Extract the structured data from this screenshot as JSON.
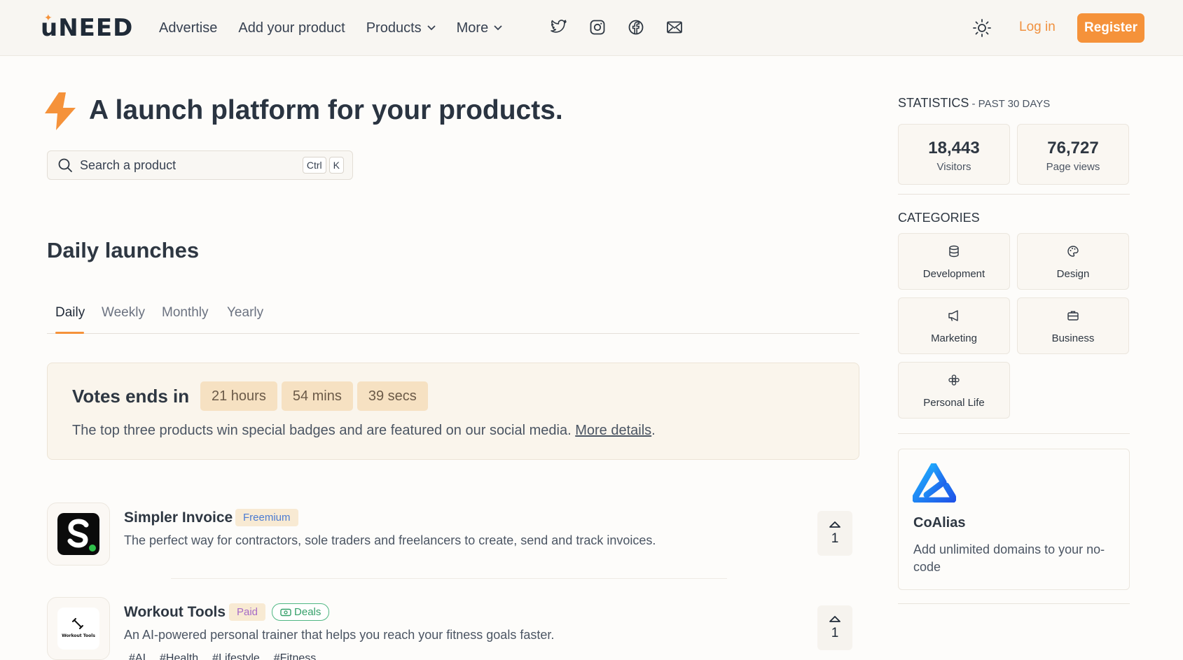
{
  "header": {
    "logo_text": "uNEED",
    "nav": [
      {
        "label": "Advertise",
        "dropdown": false
      },
      {
        "label": "Add your product",
        "dropdown": false
      },
      {
        "label": "Products",
        "dropdown": true
      },
      {
        "label": "More",
        "dropdown": true
      }
    ],
    "social_icons": [
      "twitter-icon",
      "instagram-icon",
      "facebook-icon",
      "mail-icon"
    ],
    "theme_icon": "sun-icon",
    "login_label": "Log in",
    "register_label": "Register",
    "accent_color": "#f5923a"
  },
  "hero": {
    "icon": "lightning-bolt-icon",
    "title": "A launch platform for your products.",
    "search_placeholder": "Search a product",
    "shortcut_keys": [
      "Ctrl",
      "K"
    ]
  },
  "launches": {
    "title": "Daily launches",
    "tabs": [
      "Daily",
      "Weekly",
      "Monthly",
      "Yearly"
    ],
    "active_tab": "Daily",
    "votes": {
      "label": "Votes ends in",
      "countdown": [
        "21 hours",
        "54 mins",
        "39 secs"
      ],
      "description": "The top three products win special badges and are featured on our social media. ",
      "link_text": "More details",
      "period": "."
    },
    "products": [
      {
        "name": "Simpler Invoice",
        "badges": [
          "Freemium"
        ],
        "description": "The perfect way for contractors, sole traders and freelancers to create, send and track invoices.",
        "tags": [],
        "votes": "1"
      },
      {
        "name": "Workout Tools",
        "badges": [
          "Paid",
          "Deals"
        ],
        "description": "An AI-powered personal trainer that helps you reach your fitness goals faster.",
        "tags": [
          "#AI",
          "#Health",
          "#Lifestyle",
          "#Fitness"
        ],
        "votes": "1"
      }
    ]
  },
  "sidebar": {
    "stats_title": "STATISTICS",
    "stats_subtitle": " - PAST 30 DAYS",
    "stats": [
      {
        "value": "18,443",
        "label": "Visitors"
      },
      {
        "value": "76,727",
        "label": "Page views"
      }
    ],
    "categories_title": "CATEGORIES",
    "categories": [
      {
        "label": "Development",
        "icon": "database-icon"
      },
      {
        "label": "Design",
        "icon": "palette-icon"
      },
      {
        "label": "Marketing",
        "icon": "megaphone-icon"
      },
      {
        "label": "Business",
        "icon": "briefcase-icon"
      },
      {
        "label": "Personal Life",
        "icon": "flower-icon"
      }
    ],
    "promo": {
      "name": "CoAlias",
      "description": "Add unlimited domains to your no-code"
    }
  }
}
